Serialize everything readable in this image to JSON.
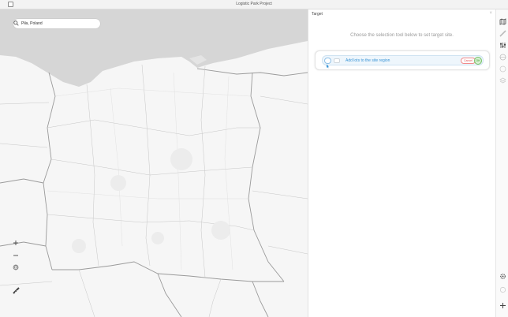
{
  "window": {
    "title": "Logistic Park Project"
  },
  "map": {
    "search": {
      "value": "Piła, Poland"
    },
    "controls": {
      "zoom_in": "zoom-in-icon",
      "zoom_out": "zoom-out-icon",
      "globe": "globe-icon",
      "measure": "ruler-icon"
    }
  },
  "panel": {
    "header": "Target",
    "hint": "Choose the selection tool below to set target site.",
    "card": {
      "label": "Add lots to the site region",
      "cancel_label": "Cancel",
      "ok_label": "OK"
    }
  },
  "rail": {
    "icons": [
      "map-icon",
      "ruler-icon",
      "sliders-icon",
      "globe-icon",
      "layers-icon",
      "stack-icon",
      "settings-icon",
      "info-icon",
      "plus-icon"
    ]
  },
  "colors": {
    "accent": "#3793d6",
    "cancel": "#e05a5a",
    "ok": "#3a9a2a",
    "water": "#d6d6d6"
  }
}
